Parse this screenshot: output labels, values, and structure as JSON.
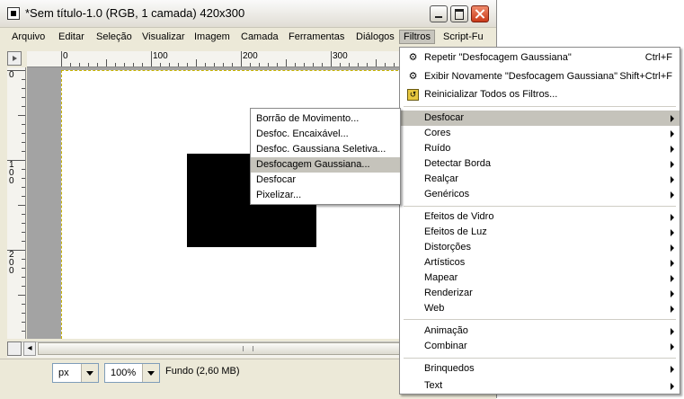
{
  "window": {
    "title": "*Sem título-1.0 (RGB, 1 camada) 420x300"
  },
  "menubar": {
    "items": [
      "Arquivo",
      "Editar",
      "Seleção",
      "Visualizar",
      "Imagem",
      "Camada",
      "Ferramentas",
      "Diálogos",
      "Filtros",
      "Script-Fu"
    ],
    "active": "Filtros"
  },
  "rulers": {
    "horizontal_labels": [
      "0",
      "100",
      "200",
      "300"
    ],
    "vertical_labels": [
      "0",
      "100",
      "200"
    ]
  },
  "statusbar": {
    "unit": "px",
    "zoom": "100%",
    "info": "Fundo (2,60 MB)"
  },
  "filters_menu": {
    "top_items": [
      {
        "icon": "gear-icon",
        "label": "Repetir \"Desfocagem Gaussiana\"",
        "shortcut": "Ctrl+F"
      },
      {
        "icon": "reshow-icon",
        "label": "Exibir Novamente \"Desfocagem Gaussiana\"",
        "shortcut": "Shift+Ctrl+F"
      },
      {
        "icon": "reset-icon",
        "label": "Reinicializar Todos os Filtros...",
        "shortcut": ""
      }
    ],
    "group1": [
      "Desfocar",
      "Cores",
      "Ruído",
      "Detectar Borda",
      "Realçar",
      "Genéricos"
    ],
    "group2": [
      "Efeitos de Vidro",
      "Efeitos de Luz",
      "Distorções",
      "Artísticos",
      "Mapear",
      "Renderizar",
      "Web"
    ],
    "group3": [
      "Animação",
      "Combinar"
    ],
    "group4": [
      "Brinquedos",
      "Text"
    ],
    "highlighted": "Desfocar"
  },
  "blur_submenu": {
    "items": [
      "Borrão de Movimento...",
      "Desfoc. Encaixável...",
      "Desfoc. Gaussiana Seletiva...",
      "Desfocagem Gaussiana...",
      "Desfocar",
      "Pixelizar..."
    ],
    "highlighted": "Desfocagem Gaussiana..."
  }
}
